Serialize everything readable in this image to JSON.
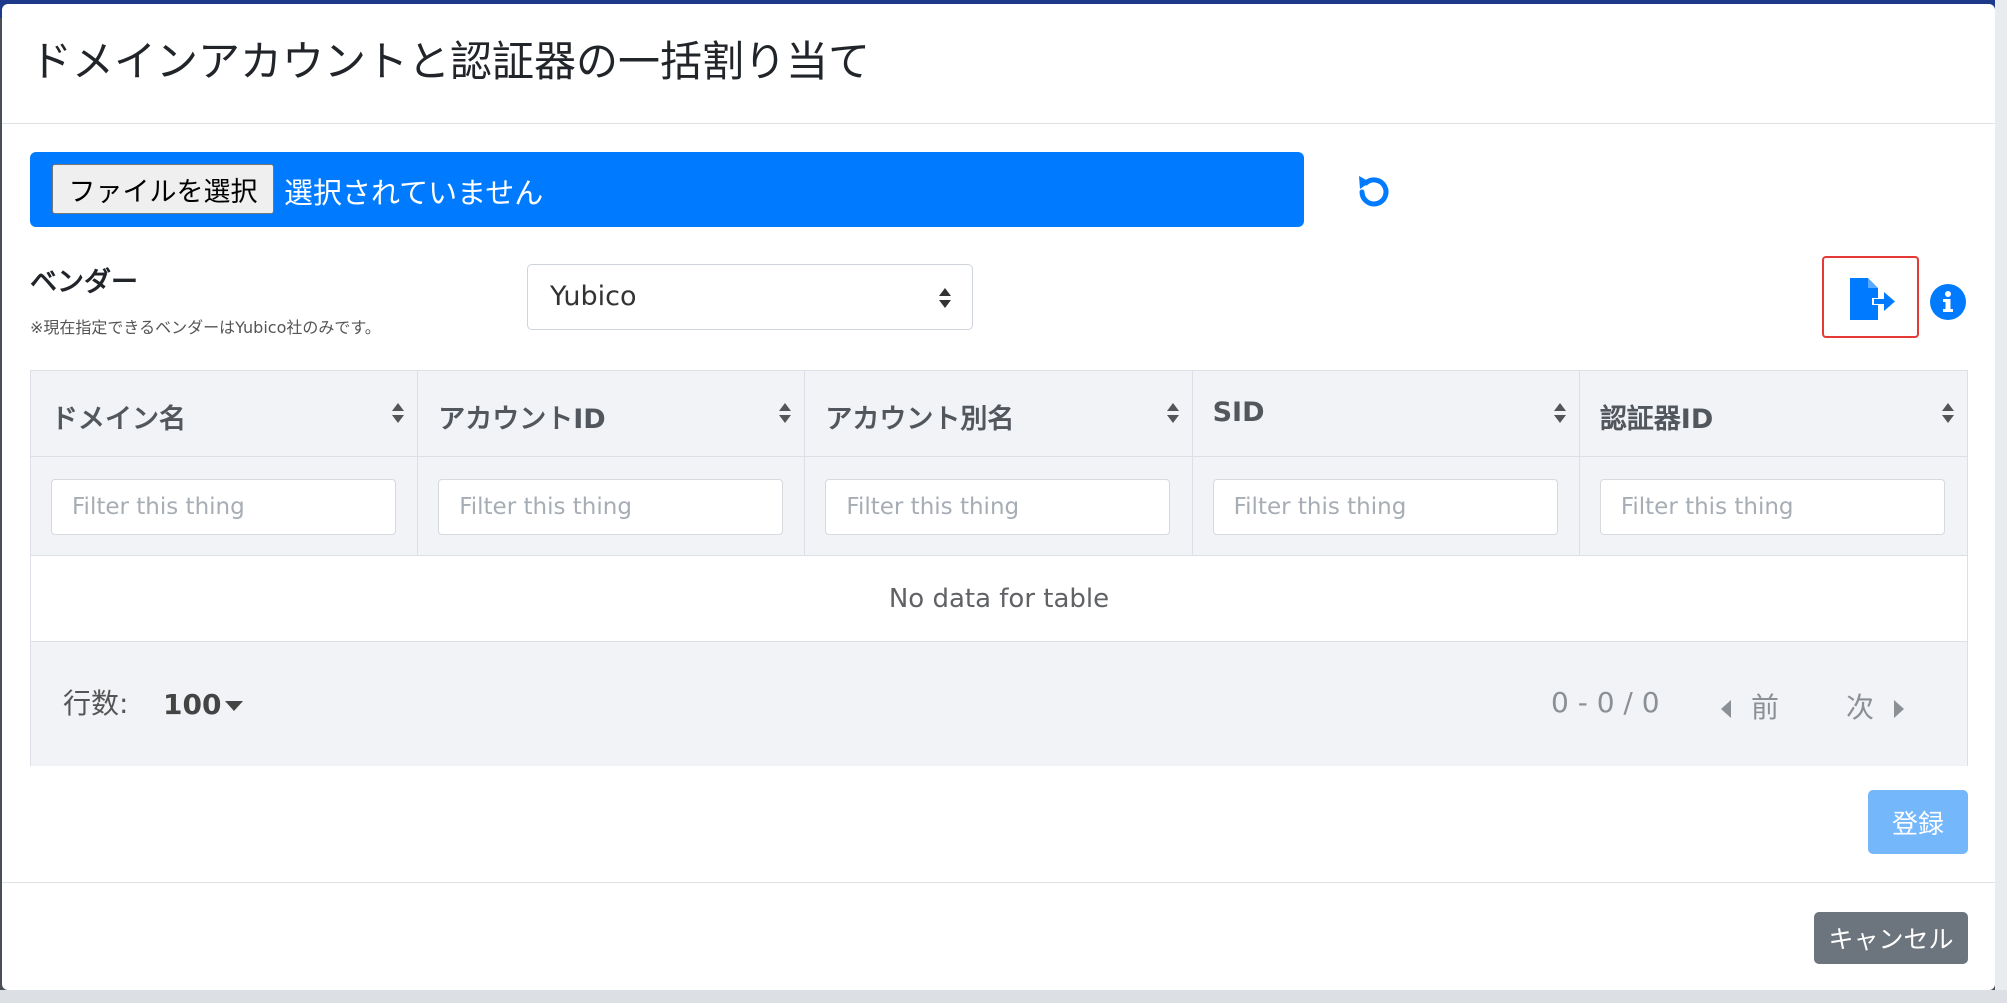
{
  "modal": {
    "title": "ドメインアカウントと認証器の一括割り当て"
  },
  "file_picker": {
    "button_label": "ファイルを選択",
    "status": "選択されていません",
    "bar_color": "#007bff"
  },
  "vendor": {
    "label": "ベンダー",
    "note": "※現在指定できるベンダーはYubico社のみです。",
    "selected": "Yubico"
  },
  "icons": {
    "refresh": "refresh-icon",
    "export": "file-export-icon",
    "info": "info-circle-icon"
  },
  "table": {
    "columns": [
      "ドメイン名",
      "アカウントID",
      "アカウント別名",
      "SID",
      "認証器ID"
    ],
    "filter_placeholder": "Filter this thing",
    "empty_text": "No data for table",
    "rows_label": "行数:",
    "rows_per_page": "100",
    "page_info": "0 - 0 / 0",
    "prev_label": "前",
    "next_label": "次"
  },
  "actions": {
    "register_label": "登録",
    "cancel_label": "キャンセル",
    "register_color": "#74b7fb",
    "cancel_color": "#6c757d"
  }
}
